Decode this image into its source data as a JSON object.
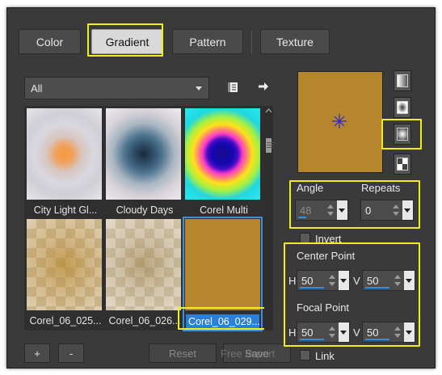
{
  "tabs": [
    {
      "label": "Color",
      "active": false
    },
    {
      "label": "Gradient",
      "active": true
    },
    {
      "label": "Pattern",
      "active": false
    },
    {
      "label": "Texture",
      "active": false
    }
  ],
  "filter": {
    "value": "All"
  },
  "icons": {
    "library": "book-icon",
    "arrow": "arrow-right-icon"
  },
  "swatches": [
    {
      "label": "City Light Gl...",
      "selected": false
    },
    {
      "label": "Cloudy Days",
      "selected": false
    },
    {
      "label": "Corel Multi",
      "selected": false
    },
    {
      "label": "Corel_06_025...",
      "selected": false
    },
    {
      "label": "Corel_06_026...",
      "selected": false
    },
    {
      "label": "Corel_06_029...",
      "selected": true
    }
  ],
  "buttons": {
    "add": "+",
    "remove": "-",
    "reset": "Reset",
    "save": "Save"
  },
  "watermark": "Free Import",
  "angle": {
    "label": "Angle",
    "value": "48"
  },
  "repeats": {
    "label": "Repeats",
    "value": "0"
  },
  "invert": {
    "label": "Invert",
    "checked": false
  },
  "center_point": {
    "label": "Center Point",
    "h_label": "H",
    "h_value": "50",
    "v_label": "V",
    "v_value": "50"
  },
  "focal_point": {
    "label": "Focal Point",
    "h_label": "H",
    "h_value": "50",
    "v_label": "V",
    "v_value": "50"
  },
  "link": {
    "label": "Link",
    "checked": false
  },
  "colors": {
    "highlight": "#f2ee1c",
    "selection": "#2c7fd6",
    "preview": "#b5862c",
    "accent_bar": "#2f8fe6"
  }
}
